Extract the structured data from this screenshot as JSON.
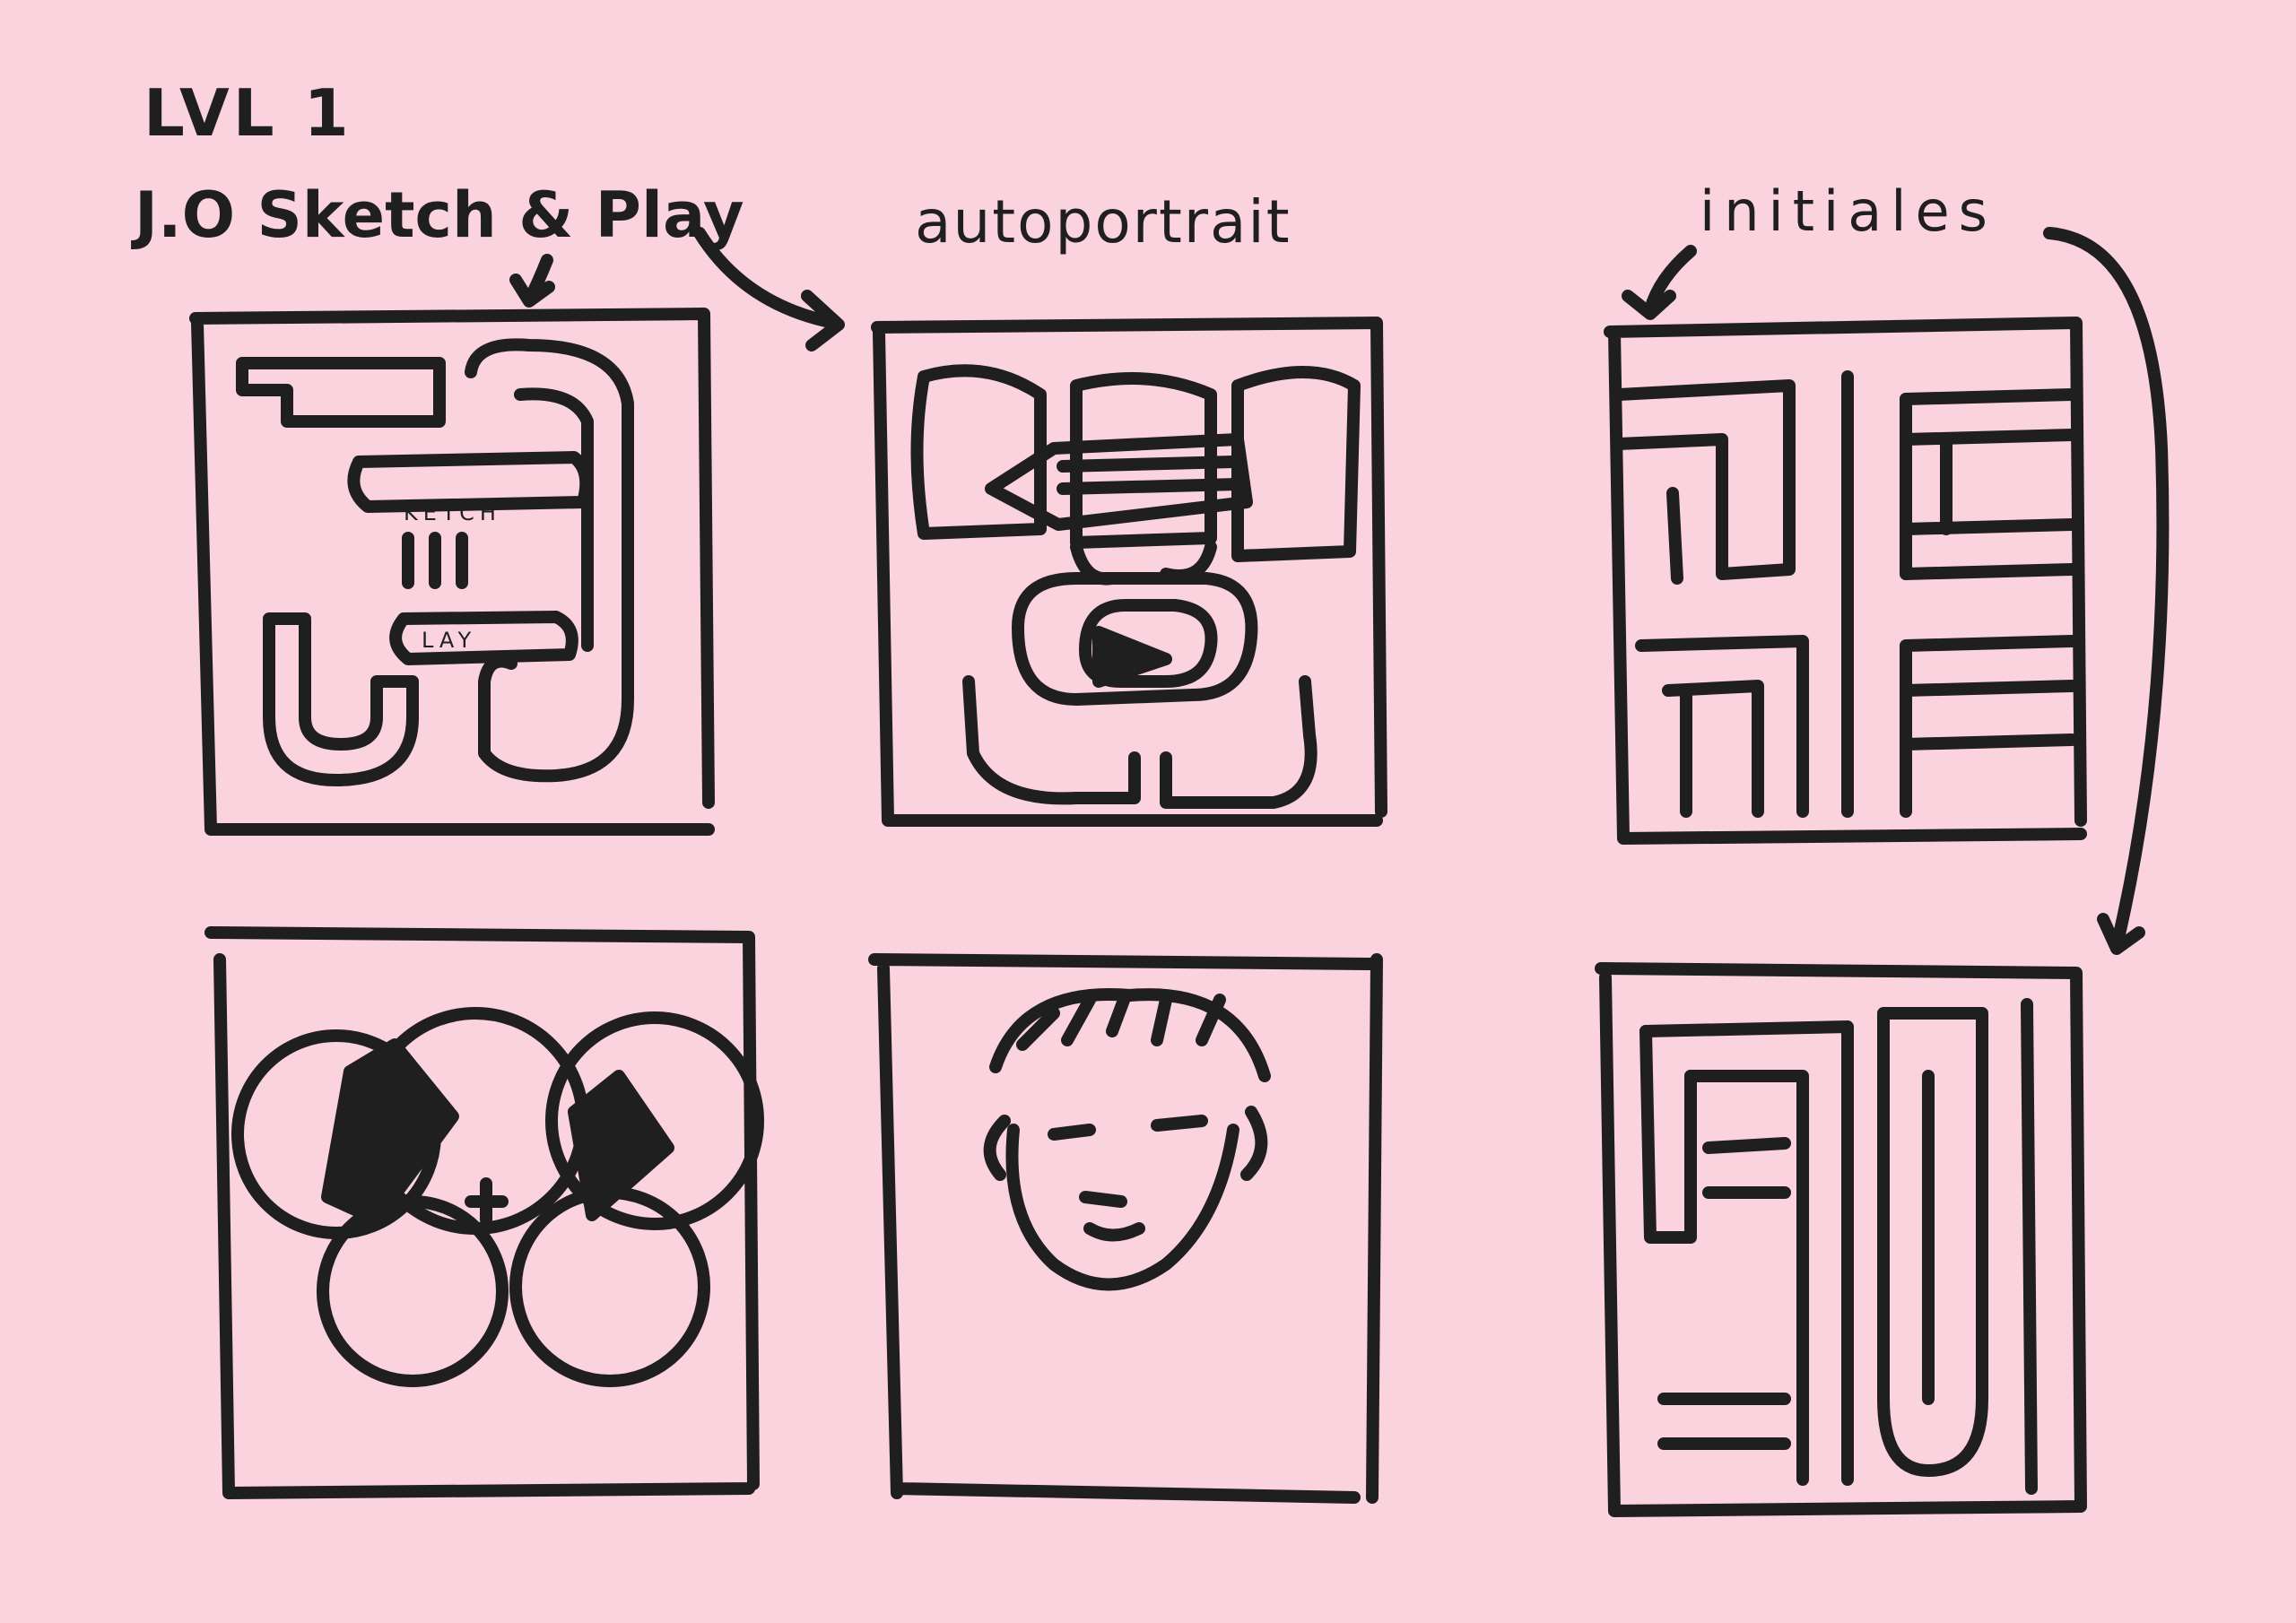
{
  "page": {
    "level": "LVL 1",
    "project": "J.O Sketch & Play",
    "labels": {
      "autoportrait": "autoportrait",
      "initiales": "initiales"
    }
  },
  "sketches": [
    {
      "id": "logo-js-letters",
      "texts": [
        "KETCH",
        "LAY"
      ]
    },
    {
      "id": "logo-portrait-pencil-play"
    },
    {
      "id": "logo-initials-maze"
    },
    {
      "id": "logo-olympic-rings-pencil"
    },
    {
      "id": "self-portrait-face"
    },
    {
      "id": "logo-initials-maze-2"
    }
  ],
  "colors": {
    "paper": "#fbd3df",
    "ink": "#1f1f1f"
  }
}
